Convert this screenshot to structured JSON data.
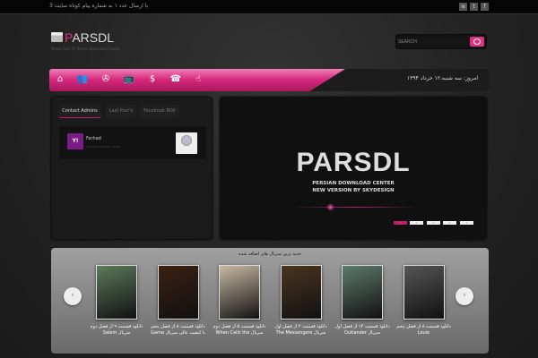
{
  "topbar": {
    "message": "با ارسال عدد ۱ به شماره پیام کوتاه سایت 3",
    "social": [
      "rss-icon",
      "twitter-icon",
      "facebook-icon"
    ],
    "social_glyphs": [
      "≋",
      "t",
      "f"
    ]
  },
  "logo": {
    "first": "P",
    "rest": "ARSDL",
    "tagline": "Movie And TV Series Download Center"
  },
  "search": {
    "placeholder": "SEARCH"
  },
  "nav": {
    "icons": [
      {
        "name": "home-icon",
        "glyph": "⌂"
      },
      {
        "name": "users-icon",
        "glyph": "👥"
      },
      {
        "name": "film-reel-icon",
        "glyph": "✇"
      },
      {
        "name": "tv-icon",
        "glyph": "📺"
      },
      {
        "name": "dollar-icon",
        "glyph": "$"
      },
      {
        "name": "phone-icon",
        "glyph": "☎"
      },
      {
        "name": "pointer-icon",
        "glyph": "☝"
      }
    ],
    "date": "امروز: سه شنبه،۱۲ خرداد ۱۳۹۴"
  },
  "left_panel": {
    "tabs": [
      "Contact Admins",
      "Last Post's",
      "Facebook BOX"
    ],
    "contact": {
      "name": "Farhad",
      "subtitle": "CONTACT PARSDL ADMIN",
      "badge": "Y!"
    }
  },
  "slider": {
    "title": "PARSDL",
    "subtitle1": "PERSIAN DOWNLOAD CENTER",
    "subtitle2": "NEW VERSION BY SKYDESIGN",
    "pages": [
      "1",
      "2",
      "3",
      "4",
      "5"
    ],
    "active_page": 1
  },
  "carousel": {
    "title": "جدید ترین سریال های اضافه شده",
    "prev": "‹",
    "next": "›",
    "items": [
      {
        "caption": "دانلود قسمت ۹ از فصل دوم سریال Salem",
        "color": "#5c7a5a"
      },
      {
        "caption": "دانلود قسمت ۸ از فصل پنجم با کیفیت عالی سریال Game",
        "color": "#3a2012"
      },
      {
        "caption": "دانلود قسمت ۵ از فصل دوم سریال When Calls the",
        "color": "#c9b9a2"
      },
      {
        "caption": "دانلود قسمت ۲ از فصل اول سریال The Messengers",
        "color": "#4a3520"
      },
      {
        "caption": "دانلود قسمت ۱۴ از فصل اول سریال Outlander",
        "color": "#5d7a6e"
      },
      {
        "caption": "دانلود قسمت ۸ از فصل پنجم Louie",
        "color": "#555"
      }
    ]
  }
}
